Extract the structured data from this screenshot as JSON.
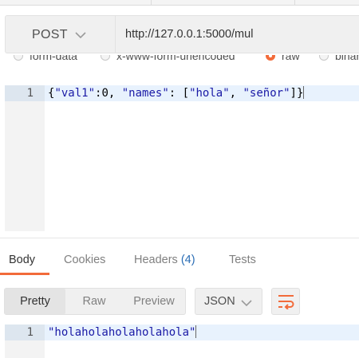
{
  "request": {
    "method": "POST",
    "url": "http://127.0.0.1:5000/mul"
  },
  "body_types": [
    {
      "label": "form-data",
      "selected": false
    },
    {
      "label": "x-www-form-urlencoded",
      "selected": false
    },
    {
      "label": "raw",
      "selected": true
    },
    {
      "label": "binary",
      "selected": false
    }
  ],
  "request_editor": {
    "line_number": "1",
    "tokens": {
      "t1": "{",
      "t2": "\"val1\"",
      "t3": ":",
      "t4": "0",
      "t5": ", ",
      "t6": "\"names\"",
      "t7": ": [",
      "t8": "\"hola\"",
      "t9": ", ",
      "t10": "\"señor\"",
      "t11": "]}"
    }
  },
  "response_tabs": {
    "body": "Body",
    "cookies": "Cookies",
    "headers": "Headers",
    "headers_count": "(4)",
    "tests": "Tests",
    "active": "Body"
  },
  "view_modes": {
    "pretty": "Pretty",
    "raw": "Raw",
    "preview": "Preview",
    "active": "Pretty"
  },
  "format": {
    "selected": "JSON"
  },
  "response_editor": {
    "line_number": "1",
    "text": "\"holaholaholaholahola\""
  },
  "colors": {
    "accent": "#f26b3a",
    "count": "#2a6db5",
    "string": "#1a1aa6"
  },
  "icons": {
    "method_dropdown": "chevron-down-icon",
    "format_dropdown": "chevron-down-icon",
    "wrap": "wrap-lines-icon"
  }
}
